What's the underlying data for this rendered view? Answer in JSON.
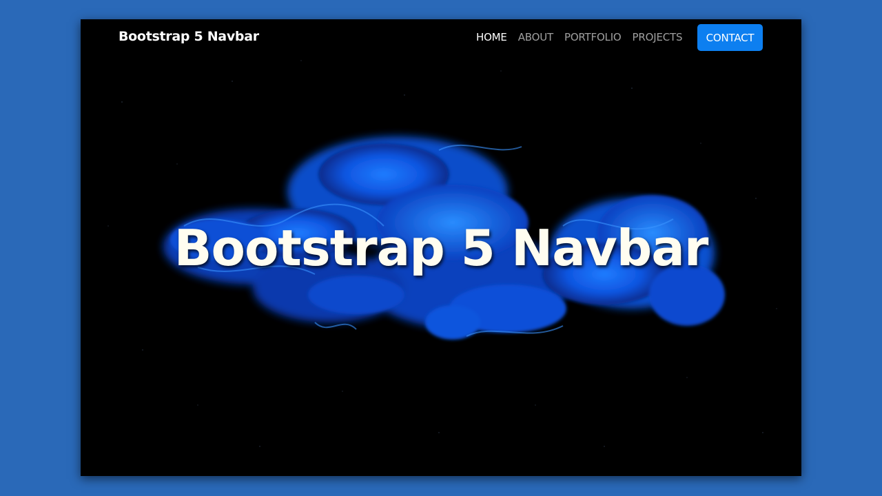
{
  "navbar": {
    "brand": "Bootstrap 5 Navbar",
    "links": [
      {
        "label": "HOME",
        "active": true
      },
      {
        "label": "ABOUT",
        "active": false
      },
      {
        "label": "PORTFOLIO",
        "active": false
      },
      {
        "label": "PROJECTS",
        "active": false
      }
    ],
    "contact_label": "CONTACT"
  },
  "hero": {
    "title": "Bootstrap 5 Navbar",
    "background_image": "blue ink cloud in water on black background"
  },
  "colors": {
    "page_background": "#2a69b8",
    "hero_background": "#000000",
    "accent_button": "#0d7ff0",
    "smoke_blue": "#1060e8",
    "title_text": "#fffdf0"
  }
}
